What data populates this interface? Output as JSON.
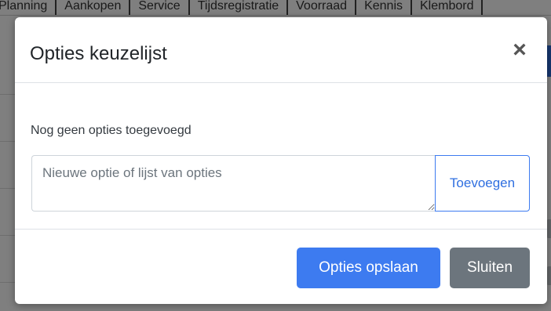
{
  "background": {
    "nav_items": [
      "Planning",
      "Aankopen",
      "Service",
      "Tijdsregistratie",
      "Voorraad",
      "Kennis",
      "Klembord"
    ]
  },
  "modal": {
    "title": "Opties keuzelijst",
    "close_icon": "close-icon",
    "close_glyph": "×",
    "empty_message": "Nog geen opties toegevoegd",
    "option_input": {
      "value": "",
      "placeholder": "Nieuwe optie of lijst van opties"
    },
    "add_button_label": "Toevoegen",
    "save_button_label": "Opties opslaan",
    "close_button_label": "Sluiten"
  },
  "colors": {
    "primary": "#3d7bf0",
    "secondary": "#6c757d",
    "backdrop": "rgba(0,0,0,0.5)"
  }
}
